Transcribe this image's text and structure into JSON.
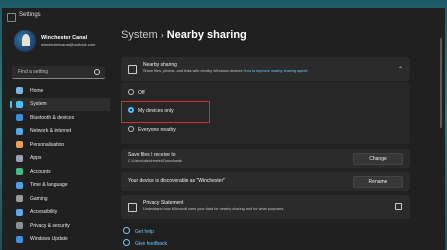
{
  "window": {
    "title": "Settings"
  },
  "profile": {
    "name": "Winchester Canal",
    "email": "winchestercanal@outlook.com"
  },
  "search": {
    "placeholder": "Find a setting"
  },
  "nav": [
    {
      "label": "Home",
      "icon": "home-icon",
      "color": "#7fb6e6"
    },
    {
      "label": "System",
      "icon": "system-icon",
      "color": "#4cc2ff"
    },
    {
      "label": "Bluetooth & devices",
      "icon": "bluetooth-icon",
      "color": "#3f8fe0"
    },
    {
      "label": "Network & internet",
      "icon": "network-icon",
      "color": "#5aa7e8"
    },
    {
      "label": "Personalisation",
      "icon": "brush-icon",
      "color": "#e6a25a"
    },
    {
      "label": "Apps",
      "icon": "apps-icon",
      "color": "#9aa3b5"
    },
    {
      "label": "Accounts",
      "icon": "accounts-icon",
      "color": "#3fbf7f"
    },
    {
      "label": "Time & language",
      "icon": "time-language-icon",
      "color": "#4aa3e0"
    },
    {
      "label": "Gaming",
      "icon": "gaming-icon",
      "color": "#9a9a9a"
    },
    {
      "label": "Accessibility",
      "icon": "accessibility-icon",
      "color": "#5fa8e8"
    },
    {
      "label": "Privacy & security",
      "icon": "shield-icon",
      "color": "#8a8f99"
    },
    {
      "label": "Windows Update",
      "icon": "update-icon",
      "color": "#3f8fe0"
    }
  ],
  "breadcrumb": {
    "parent": "System",
    "separator": "›",
    "current": "Nearby sharing"
  },
  "nearby": {
    "title": "Nearby sharing",
    "description": "Share files, photos, and links with nearby Windows devices",
    "link": "How to improve nearby sharing speed",
    "options": [
      "Off",
      "My devices only",
      "Everyone nearby"
    ],
    "selected": "My devices only"
  },
  "save_files": {
    "title": "Save files I receive to",
    "path": "C:\\Users\\winchester\\Downloads",
    "button": "Change"
  },
  "discoverable": {
    "text": "Your device is discoverable as \"Winchester\"",
    "button": "Rename"
  },
  "privacy": {
    "title": "Privacy Statement",
    "description": "Understand how Microsoft uses your data for nearby sharing and for what purposes"
  },
  "footer": {
    "help": "Get help",
    "feedback": "Give feedback"
  },
  "colors": {
    "accent": "#4cc2ff",
    "highlight": "#d32f2f"
  }
}
